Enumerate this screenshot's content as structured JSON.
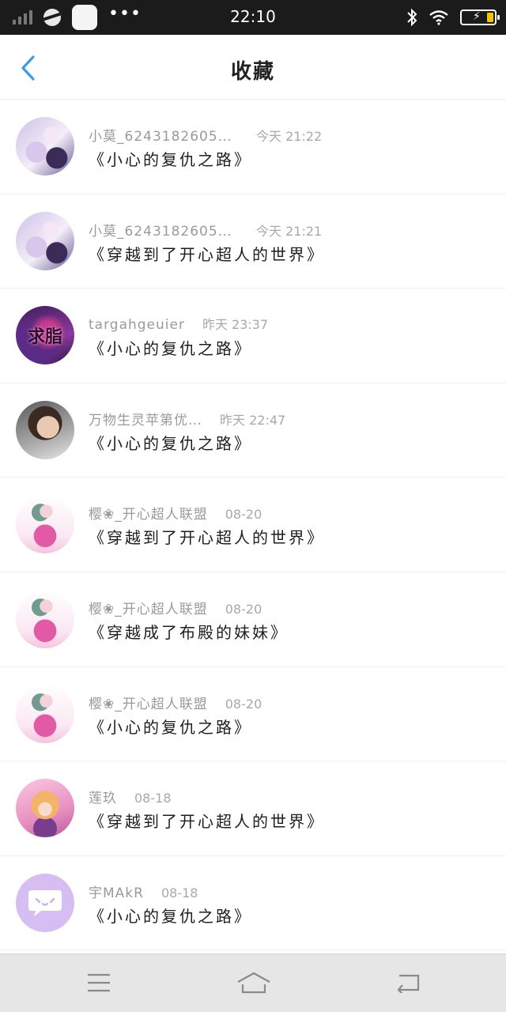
{
  "status_bar": {
    "time": "22:10",
    "icons": [
      "signal-icon",
      "app-ball-icon",
      "app-square-icon",
      "more-dots-icon",
      "bluetooth-icon",
      "wifi-icon",
      "battery-charging-icon"
    ],
    "more_dots": "•••",
    "battery_color": "#f2c500"
  },
  "header": {
    "title": "收藏",
    "back_icon": "chevron-left-icon",
    "accent": "#3a9be8"
  },
  "favorites": [
    {
      "user": "小莫_62431826059…",
      "time": "今天 21:22",
      "book": "《小心的复仇之路》",
      "avatar": "anime-girl-white-hair"
    },
    {
      "user": "小莫_62431826059…",
      "time": "今天 21:21",
      "book": "《穿越到了开心超人的世界》",
      "avatar": "anime-girl-white-hair"
    },
    {
      "user": "targahgeuier",
      "time": "昨天 23:37",
      "book": "《小心的复仇之路》",
      "avatar": "galaxy-text",
      "avatar_text": "求脂"
    },
    {
      "user": "万物生灵苹第优…",
      "time": "昨天 22:47",
      "book": "《小心的复仇之路》",
      "avatar": "girl-photo"
    },
    {
      "user": "樱❀_开心超人联盟",
      "time": "08-20",
      "book": "《穿越到了开心超人的世界》",
      "avatar": "pink-anime-girl"
    },
    {
      "user": "樱❀_开心超人联盟",
      "time": "08-20",
      "book": "《穿越成了布殿的妹妹》",
      "avatar": "pink-anime-girl"
    },
    {
      "user": "樱❀_开心超人联盟",
      "time": "08-20",
      "book": "《小心的复仇之路》",
      "avatar": "pink-anime-girl"
    },
    {
      "user": "莲玖",
      "time": "08-18",
      "book": "《穿越到了开心超人的世界》",
      "avatar": "lolita-anime-girl"
    },
    {
      "user": "宇MAkR",
      "time": "08-18",
      "book": "《小心的复仇之路》",
      "avatar": "default-chat-bubble"
    }
  ],
  "nav_bar": {
    "buttons": [
      "menu-icon",
      "home-icon",
      "back-icon"
    ]
  }
}
